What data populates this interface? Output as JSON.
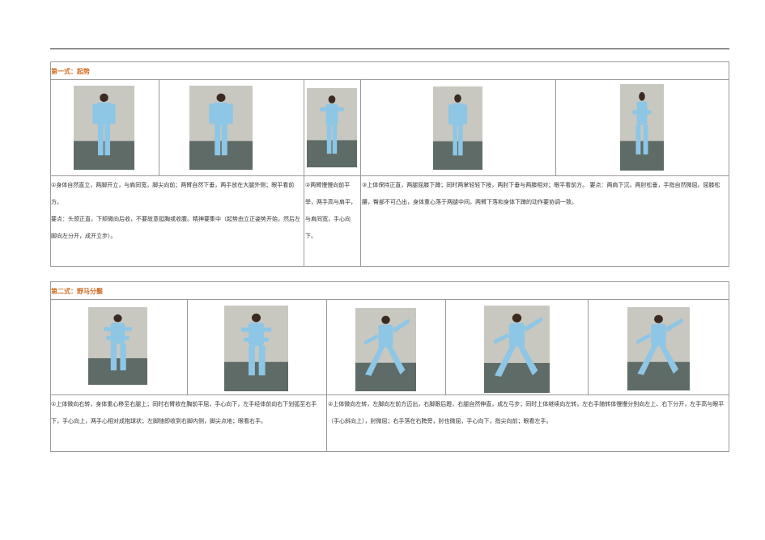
{
  "section1": {
    "title": "第一式：起势",
    "desc1": "①身体自然直立，两脚开立，与肩同宽，脚尖向前；两臂自然下垂，两手放在大腿外侧；眼平看前方。",
    "desc1b": "要点：头颈正直，下颏微向后收，不要故意挺胸或收腹。精神要集中（起势由立正姿势开始，然后左脚向左分开，成开立步）。",
    "desc2": "②两臂慢慢向前平举，两手高与肩平，与肩同宽，手心向下。",
    "desc3": "③上体保持正直，两腿屈膝下蹲；同时两掌轻轻下按，两肘下垂与两膝相对；眼平看前方。 要点：两肩下沉，两肘松垂，手指自然微屈。屈膝松腰，臀部不可凸出，身体重心落于两腿中间。两臂下落和身体下蹲的动作要协调一致。"
  },
  "section2": {
    "title": "第二式：野马分鬃",
    "desc1": "①上体微向右转，身体重心移至右腿上；同时右臂收在胸前平屈，手心向下，左手经体前向右下划弧至右手下，手心向上，两手心相对成抱球状；左脚随即收到右脚内侧，脚尖点地；眼看右手。",
    "desc2": "②上体微向左转，左脚向左前方迈出，右脚跟后蹬，右腿自然伸直，成左弓步；同时上体继续向左转，左右手随转体慢慢分别向左上、右下分开，左手高与眼平（手心斜向上），肘微屈；右手落在右胯旁，肘也微屈，手心向下，指尖向前；眼看左手。"
  },
  "colors": {
    "title": "#d2691e",
    "border": "#9a9a9a",
    "suit": "#8ec6e6",
    "wall": "#c8c8c0",
    "floor": "#5e6b66"
  }
}
